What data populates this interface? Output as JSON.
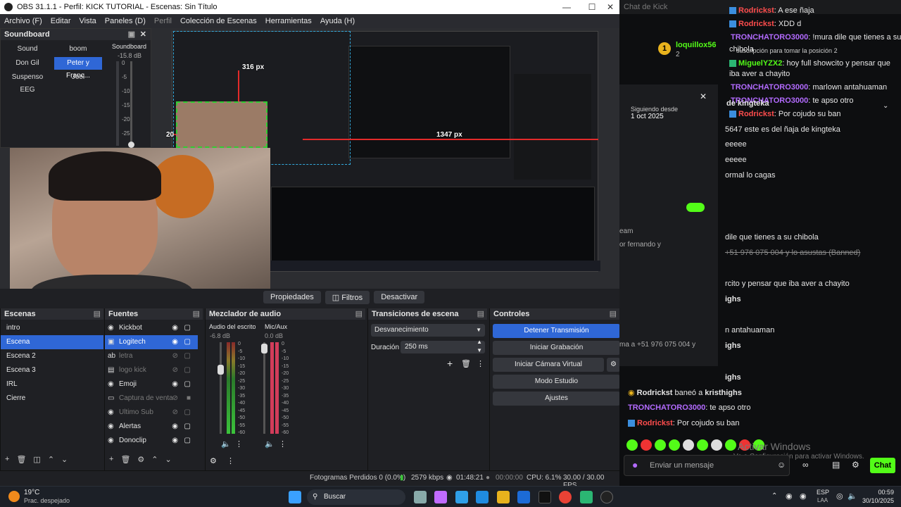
{
  "obs": {
    "title": "OBS 31.1.1 - Perfil: KICK TUTORIAL - Escenas: Sin Título",
    "menu": [
      "Archivo (F)",
      "Editar",
      "Vista",
      "Paneles (D)",
      "Perfil",
      "Colección de Escenas",
      "Herramientas",
      "Ayuda (H)"
    ],
    "preview_measure": {
      "top": "316 px",
      "left": "20 px",
      "right": "1347 px"
    },
    "soundboard": {
      "title": "Soundboard",
      "buttons": [
        "Sound",
        "boom",
        "Don Gil",
        "Peter y Franc...",
        "Suspenso EEG",
        "Joel"
      ],
      "meter_label": "Soundboard",
      "meter_db": "-15.8 dB",
      "scale": [
        "0",
        "-5",
        "-10",
        "-15",
        "-20",
        "-25"
      ]
    },
    "propbar": {
      "properties": "Propiedades",
      "filters": "Filtros",
      "deactivate": "Desactivar"
    },
    "scenes": {
      "title": "Escenas",
      "items": [
        "intro",
        "Escena",
        "Escena 2",
        "Escena 3",
        "IRL",
        "Cierre"
      ],
      "selected": 1
    },
    "sources": {
      "title": "Fuentes",
      "items": [
        "Kickbot",
        "Logitech",
        "letra",
        "logo kick",
        "Emoji",
        "Captura de venta",
        "Ultimo Sub",
        "Alertas",
        "Donoclip"
      ]
    },
    "mixer": {
      "title": "Mezclador de audio",
      "channels": [
        {
          "name": "Audio del escritorio",
          "db": "-6.8 dB"
        },
        {
          "name": "Mic/Aux",
          "db": "0.0 dB"
        }
      ],
      "scale": [
        "0",
        "-5",
        "-10",
        "-15",
        "-20",
        "-25",
        "-30",
        "-35",
        "-40",
        "-45",
        "-50",
        "-55",
        "-60"
      ]
    },
    "transitions": {
      "title": "Transiciones de escena",
      "type": "Desvanecimiento",
      "duration_label": "Duración",
      "duration": "250 ms"
    },
    "controls": {
      "title": "Controles",
      "stop_stream": "Detener Transmisión",
      "start_recording": "Iniciar Grabación",
      "start_virtualcam": "Iniciar Cámara Virtual",
      "studio_mode": "Modo Estudio",
      "settings": "Ajustes"
    },
    "status": {
      "dropped": "Fotogramas Perdidos 0 (0.0%)",
      "bitrate": "2579 kbps",
      "stream_time": "01:48:21",
      "rec_time": "00:00:00",
      "cpu": "CPU: 6.1%",
      "fps": "30.00 / 30.00 FPS"
    }
  },
  "chat": {
    "title": "Chat de Kick",
    "user": {
      "name": "loquillox56",
      "rank": "1",
      "count": "2"
    },
    "follow": {
      "label": "Siguiendo desde",
      "date": "1 oct 2025"
    },
    "lines_top": [
      {
        "user": "Rodrickst",
        "text": ": A ese ñaja",
        "color": "#ff4d4d"
      },
      {
        "user": "Rodrickst",
        "text": ": XDD d",
        "color": "#ff4d4d"
      },
      {
        "user": "TRONCHATORO3000",
        "text": ": !mura dile que tienes a su",
        "color": "#b36bff"
      },
      {
        "user": "",
        "text": "chibola",
        "color": ""
      },
      {
        "user": "",
        "text": "suscripción para tomar la posición 2",
        "color": ""
      },
      {
        "user": "MiguelYZX2",
        "text": ": hoy full showcito y pensar que",
        "color": "#53fc18"
      },
      {
        "user": "",
        "text": "iba aver a chayito",
        "color": ""
      },
      {
        "user": "TRONCHATORO3000",
        "text": ": marlown antahuaman",
        "color": "#b36bff"
      },
      {
        "user": "TRONCHATORO3000",
        "text": ": te apso otro",
        "color": "#b36bff"
      },
      {
        "user": "Rodrickst",
        "text": ": Por cojudo su ban",
        "color": "#ff4d4d"
      }
    ],
    "lines_mid": [
      "de kingteka",
      "5647 este es del ñaja de kingteka",
      "eeeee",
      "eeeee",
      "ormal lo cagas",
      "dile que tienes a su chibola",
      "+51 976 075 004 y lo asustas (Banned)",
      "rcito y pensar que iba aver a chayito",
      "ighs",
      "n antahuaman",
      "ighs",
      "ighs"
    ],
    "lines_bottom": [
      {
        "user": "Rodrickst",
        "text": " baneó a ",
        "target": "kristhighs",
        "color": "#e6e6e6"
      },
      {
        "user": "TRONCHATORO3000",
        "text": ": te apso otro",
        "target": "",
        "color": "#b36bff"
      },
      {
        "user": "Rodrickst",
        "text": ": Por cojudo su ban",
        "target": "",
        "color": "#ff4d4d"
      }
    ],
    "panel_texts": [
      "eam",
      "or fernando y",
      "ma a +51 976 075 004 y"
    ],
    "input_placeholder": "Enviar un mensaje",
    "send": "Chat",
    "watermark_1": "Activar Windows",
    "watermark_2": "Ve a Configuración para activar Windows."
  },
  "taskbar": {
    "weather_temp": "19°C",
    "weather_desc": "Prac. despejado",
    "search": "Buscar",
    "lang": "ESP",
    "lang2": "LAA",
    "time": "00:59",
    "date": "30/10/2025"
  }
}
